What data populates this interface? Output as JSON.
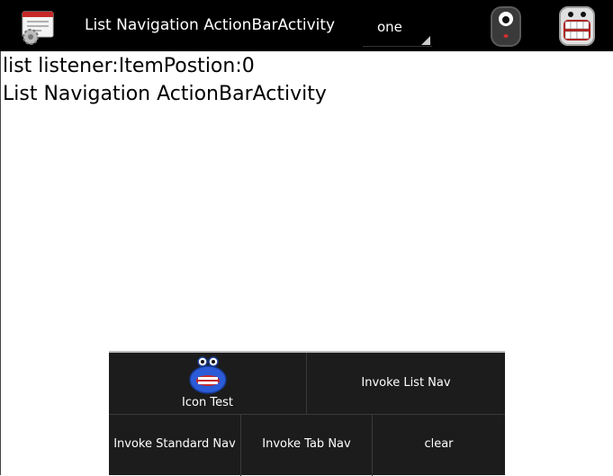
{
  "actionbar": {
    "title": "List Navigation ActionBarActivity",
    "app_icon": "settings-window-icon",
    "spinner": {
      "selected": "one"
    },
    "actions": [
      {
        "icon": "one-eyed-monster-icon"
      },
      {
        "icon": "teeth-monster-icon"
      }
    ]
  },
  "content": {
    "line1": "list listener:ItemPostion:0",
    "line2": "List Navigation ActionBarActivity"
  },
  "menu": {
    "icon_test": {
      "label": "Icon Test",
      "icon": "blue-monster-icon"
    },
    "list_nav": "Invoke List Nav",
    "standard_nav": "Invoke Standard Nav",
    "tab_nav": "Invoke Tab Nav",
    "clear": "clear"
  }
}
